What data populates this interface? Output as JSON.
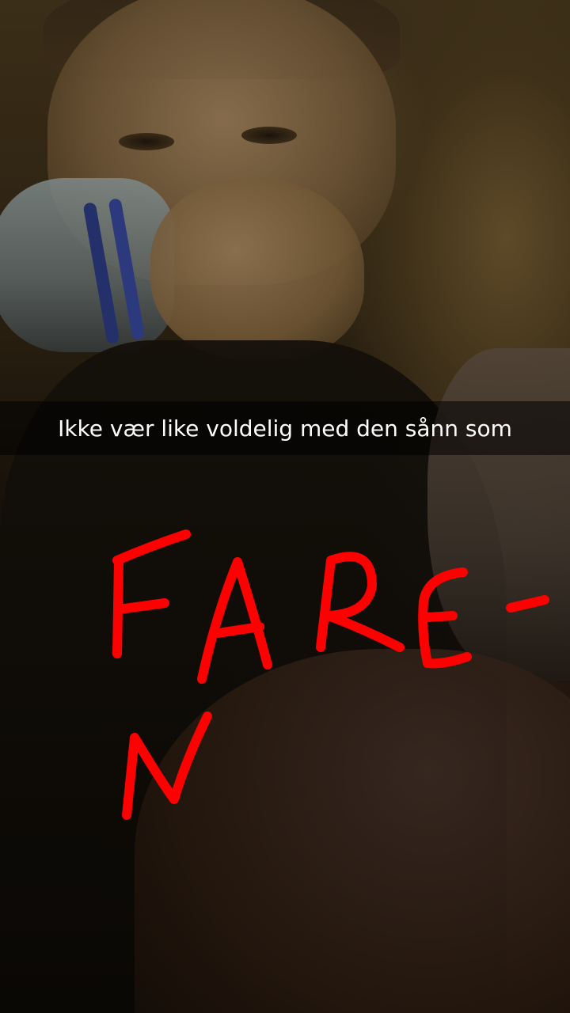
{
  "snap": {
    "caption": "Ikke vær like voldelig med den sånn som",
    "drawing_text": "FARE- N",
    "drawing_color": "#ff0000"
  }
}
